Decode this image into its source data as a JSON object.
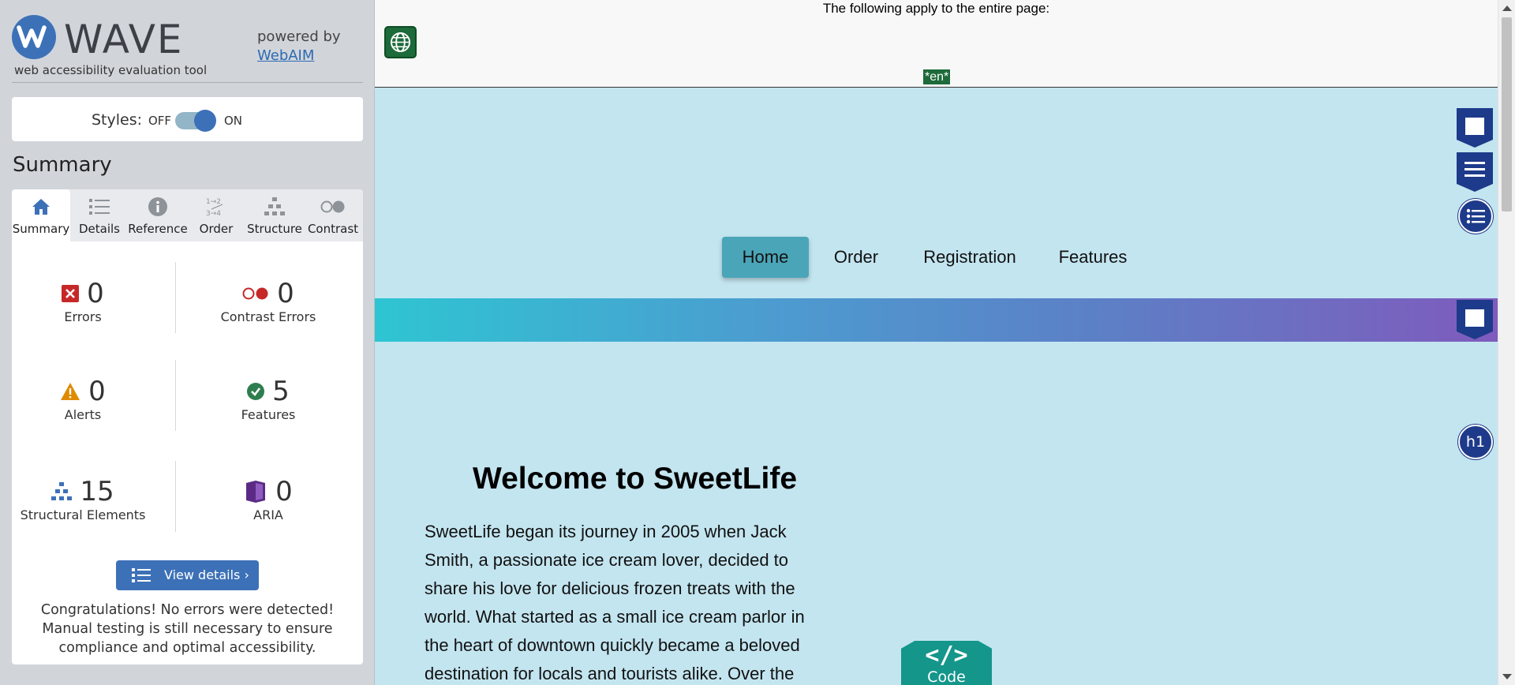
{
  "wave": {
    "logo_text": "WAVE",
    "tagline": "web accessibility evaluation tool",
    "powered_by": "powered by",
    "webaim_link": "WebAIM",
    "styles_label": "Styles:",
    "styles_off": "OFF",
    "styles_on": "ON",
    "styles_enabled": true,
    "summary_heading": "Summary",
    "tabs": [
      {
        "label": "Summary",
        "icon": "home-icon",
        "active": true
      },
      {
        "label": "Details",
        "icon": "list-icon",
        "active": false
      },
      {
        "label": "Reference",
        "icon": "info-icon",
        "active": false
      },
      {
        "label": "Order",
        "icon": "order-icon",
        "active": false
      },
      {
        "label": "Structure",
        "icon": "structure-icon",
        "active": false
      },
      {
        "label": "Contrast",
        "icon": "contrast-icon",
        "active": false
      }
    ],
    "stats": {
      "errors": {
        "count": "0",
        "label": "Errors"
      },
      "contrast_errors": {
        "count": "0",
        "label": "Contrast Errors"
      },
      "alerts": {
        "count": "0",
        "label": "Alerts"
      },
      "features": {
        "count": "5",
        "label": "Features"
      },
      "structural": {
        "count": "15",
        "label": "Structural Elements"
      },
      "aria": {
        "count": "0",
        "label": "ARIA"
      }
    },
    "view_details": "View details ›",
    "congrats": "Congratulations! No errors were detected! Manual testing is still necessary to ensure compliance and optimal accessibility."
  },
  "page": {
    "notice": "The following apply to the entire page:",
    "lang_tag": "*en*",
    "nav": [
      "Home",
      "Order",
      "Registration",
      "Features"
    ],
    "active_nav": "Home",
    "heading": "Welcome to SweetLife",
    "paragraph": "SweetLife began its journey in 2005 when Jack Smith, a passionate ice cream lover, decided to share his love for delicious frozen treats with the world. What started as a small ice cream parlor in the heart of downtown quickly became a beloved destination for locals and tourists alike. Over the",
    "code_badge_symbol": "</>",
    "code_badge_label": "Code",
    "h1_marker": "h1"
  },
  "colors": {
    "wave_blue": "#3d71b7",
    "sidebar_bg": "#d1d5da",
    "content_bg": "#c3e5f0",
    "error_red": "#c62828",
    "alert_orange": "#e08a00",
    "feature_green": "#2e7d4f",
    "aria_purple": "#5b2a86",
    "code_teal": "#14968b"
  }
}
